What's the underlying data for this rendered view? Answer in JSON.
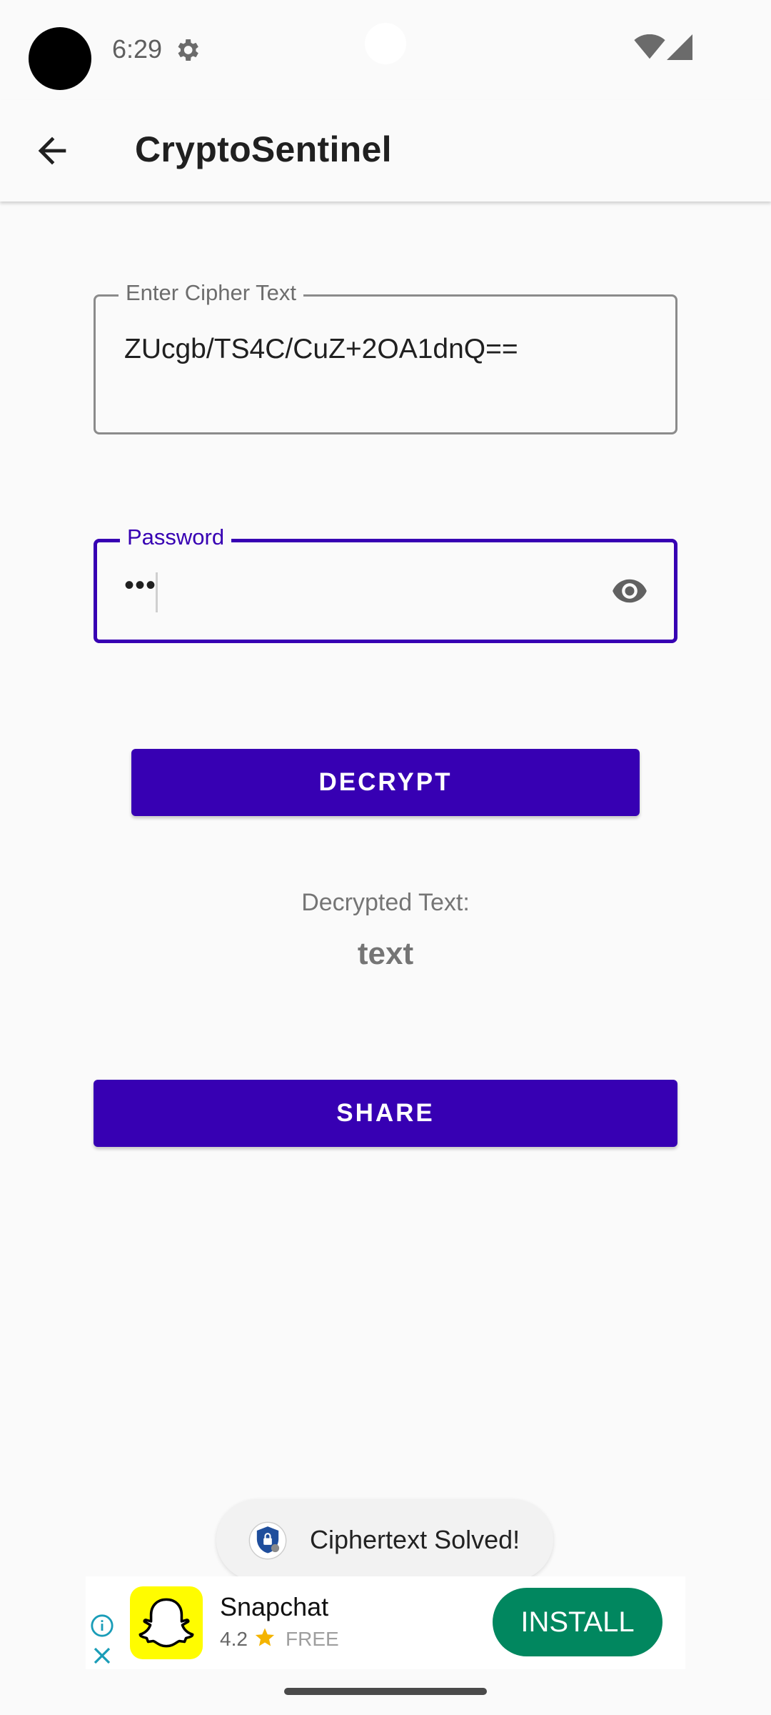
{
  "status_bar": {
    "time": "6:29"
  },
  "app_bar": {
    "title": "CryptoSentinel"
  },
  "cipher_field": {
    "label": "Enter Cipher Text",
    "value": "ZUcgb/TS4C/CuZ+2OA1dnQ=="
  },
  "password_field": {
    "label": "Password",
    "value": "•••"
  },
  "actions": {
    "decrypt_label": "DECRYPT",
    "share_label": "SHARE"
  },
  "result": {
    "label": "Decrypted Text:",
    "value": "text"
  },
  "toast": {
    "message": "Ciphertext Solved!"
  },
  "ad": {
    "app_name": "Snapchat",
    "rating": "4.2",
    "price": "FREE",
    "install_label": "INSTALL"
  },
  "colors": {
    "primary": "#3700B3",
    "install": "#01875F",
    "snapchat_yellow": "#FFFC00"
  }
}
